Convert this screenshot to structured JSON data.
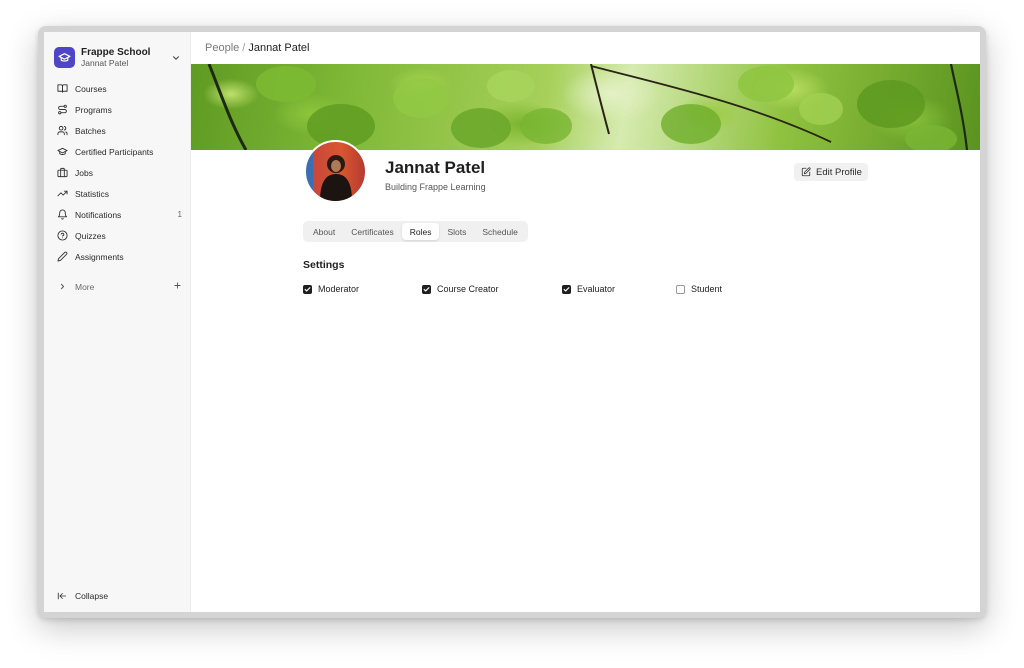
{
  "workspace": {
    "name": "Frappe School",
    "user": "Jannat Patel"
  },
  "sidebar": {
    "items": [
      {
        "label": "Courses",
        "icon": "book-icon"
      },
      {
        "label": "Programs",
        "icon": "route-icon"
      },
      {
        "label": "Batches",
        "icon": "users-icon"
      },
      {
        "label": "Certified Participants",
        "icon": "graduation-cap-icon"
      },
      {
        "label": "Jobs",
        "icon": "briefcase-icon"
      },
      {
        "label": "Statistics",
        "icon": "trending-up-icon"
      },
      {
        "label": "Notifications",
        "icon": "bell-icon",
        "badge": "1"
      },
      {
        "label": "Quizzes",
        "icon": "help-circle-icon"
      },
      {
        "label": "Assignments",
        "icon": "pencil-icon"
      }
    ],
    "more_label": "More",
    "collapse_label": "Collapse"
  },
  "breadcrumb": {
    "parent": "People",
    "separator": "/",
    "current": "Jannat Patel"
  },
  "profile": {
    "name": "Jannat Patel",
    "tagline": "Building Frappe Learning",
    "edit_label": "Edit Profile"
  },
  "tabs": [
    {
      "label": "About",
      "active": false
    },
    {
      "label": "Certificates",
      "active": false
    },
    {
      "label": "Roles",
      "active": true
    },
    {
      "label": "Slots",
      "active": false
    },
    {
      "label": "Schedule",
      "active": false
    }
  ],
  "settings": {
    "title": "Settings",
    "roles": [
      {
        "label": "Moderator",
        "checked": true
      },
      {
        "label": "Course Creator",
        "checked": true
      },
      {
        "label": "Evaluator",
        "checked": true
      },
      {
        "label": "Student",
        "checked": false
      }
    ]
  },
  "colors": {
    "brand": "#4f46c7",
    "checkbox": "#1f1f1f"
  }
}
